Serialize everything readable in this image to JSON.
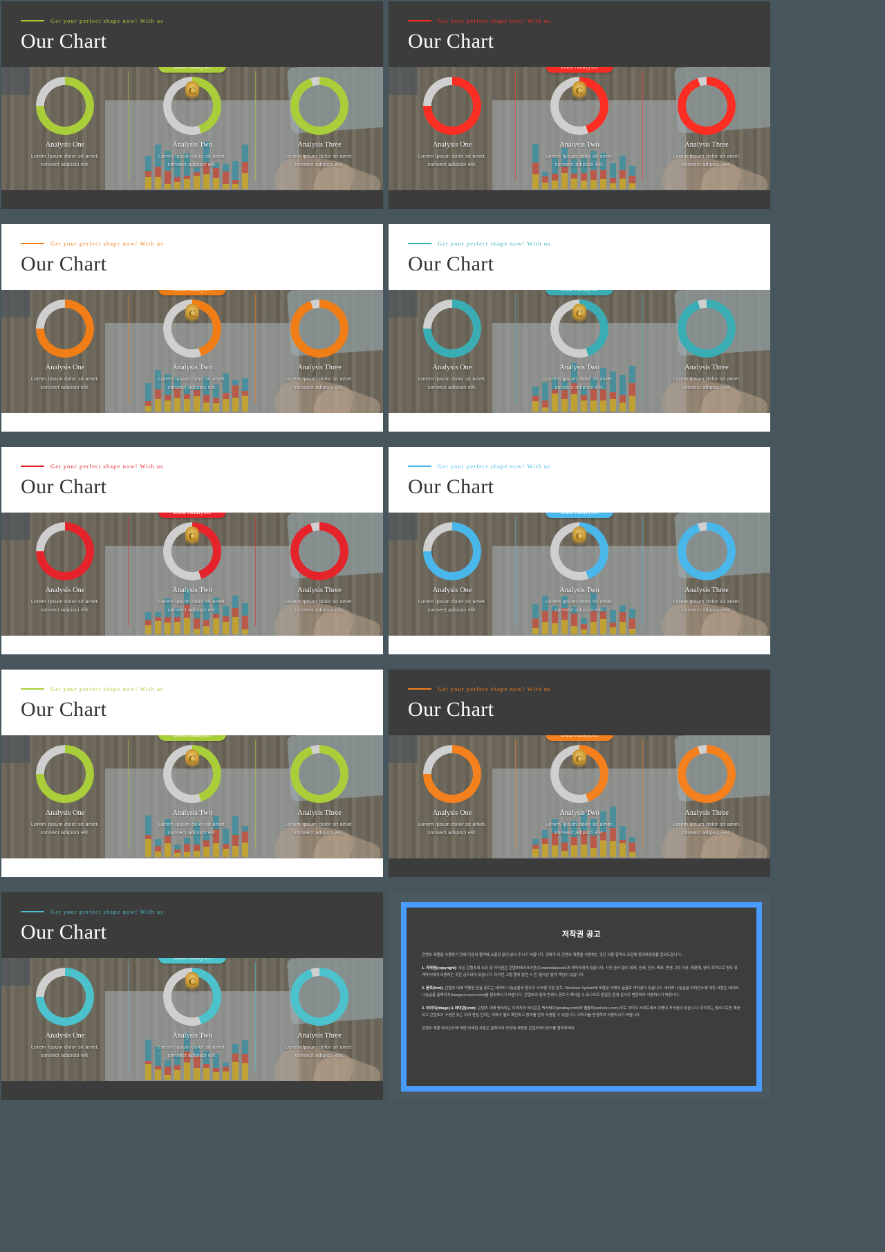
{
  "deck": {
    "tagline": "Get your perfect shape now!  With us",
    "title": "Our Chart",
    "badge_label": "Data Analysis",
    "metrics": [
      {
        "percent_label": "75%",
        "value": 75,
        "name": "Analysis One",
        "desc_line1": "Lorem Ipsum dolor sit amet.",
        "desc_line2": "consect adipisci  elit."
      },
      {
        "percent_label": "45%",
        "value": 45,
        "name": "Analysis Two",
        "desc_line1": "Lorem Ipsum dolor sit amet.",
        "desc_line2": "consect adipisci  elit."
      },
      {
        "percent_label": "95%",
        "value": 95,
        "name": "Analysis Three",
        "desc_line1": "Lorem Ipsum dolor sit amet.",
        "desc_line2": "consect adipisci  elit."
      }
    ],
    "track_color": "#cfcfcf",
    "slides": [
      {
        "id": 1,
        "accent": "#a9ce3a",
        "header": "dark",
        "footer": "dark"
      },
      {
        "id": 2,
        "accent": "#fc2d23",
        "header": "dark",
        "footer": "dark"
      },
      {
        "id": 3,
        "accent": "#f07d16",
        "header": "light",
        "footer": "light"
      },
      {
        "id": 4,
        "accent": "#3aacb4",
        "header": "light",
        "footer": "light"
      },
      {
        "id": 5,
        "accent": "#e4232a",
        "header": "light",
        "footer": "light"
      },
      {
        "id": 6,
        "accent": "#4ab7ea",
        "header": "light",
        "footer": "light"
      },
      {
        "id": 7,
        "accent": "#a9ce3a",
        "header": "light",
        "footer": "light"
      },
      {
        "id": 8,
        "accent": "#f5801e",
        "header": "dark",
        "footer": "dark"
      },
      {
        "id": 9,
        "accent": "#4cc3cc",
        "header": "dark",
        "footer": "dark"
      }
    ]
  },
  "copyright": {
    "border_color": "#4a9bff",
    "title": "저작권 공고",
    "intro": "콘텐츠 제품을 사용하기 전에 다음의 협약에 소홀함 없이 읽어 주시기 바랍니다. 귀하가 이 콘텐츠 제품을 사용하는 것은 사용 협약서 조항에 동의하셨음을 알려드립니다.",
    "sections": [
      {
        "heading": "1. 저작권(copyright)",
        "body": ": 모든 콘텐츠의 소유 및 저작권은 콘텐츠테이크아웃(Contentstakeout)과 계약사에게 있습니다. 사전 승낙 없이 복제, 인쇄, 전시, 배포, 변경, 2차 가공, 재판매, 영리 목적으로 양도 및 계약사에게 이용하는 것은 금지되어 있습니다. 이러한 고법 행위 발견 시 민·형사상 법적 책임이 있습니다."
      },
      {
        "heading": "2. 폰트(font)",
        "body": ": 콘텐츠 내에 적용된 한글 폰트는 네이버 나눔글꼴과 윈도우 시스템 기본 폰트, Windows System에 포함된 서체의 글꼴로 저작권이 있습니다. 네이버 나눔글꼴 라이선스에 대한 사항은 네이버 나눔글꼴 홈페이지(hangeul.naver.com)를 참조하시기 바랍니다. 콘텐츠의 형태 변경시 폰트가 깨어질 수 있으므로 동일한 환경 문서로 변환하여 사용하시기 바랍니다."
      },
      {
        "heading": "3. 이미지(image) & 아이콘(icon)",
        "body": ": 콘텐츠 내에 명시되는 이미지와 아이콘은 픽사베이(pixabay.com)와 웹볼리(webolys.com) 무료 이미지 사이트에서 이용이 저작권이 있습니다. 이미지는 참조으로만 제공되고 콘텐츠의 구성만 있는 이미 편집 건리는 귀하가 별도 확인하고 동의를 얻어 사용할 수 있습니다. 이미지를 변경하여 사용하시기 바랍니다."
      }
    ],
    "outro": "콘텐츠 제품 라이선스에 대한 자세한 사항은 홈페이지 사단에 사용된 콘텐츠라이선스를 참조하세요."
  }
}
